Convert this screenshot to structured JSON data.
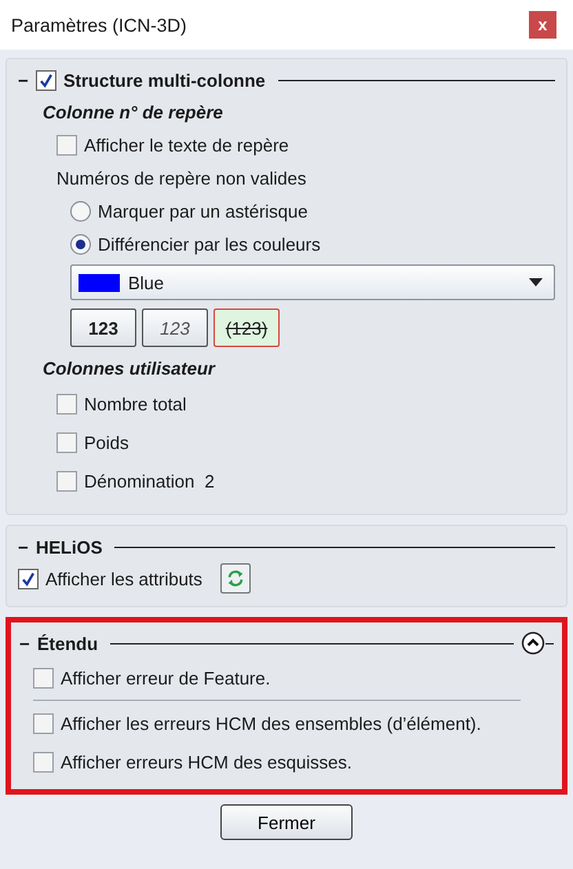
{
  "window": {
    "title": "Paramètres (ICN-3D)",
    "close": "x"
  },
  "structure": {
    "collapse": "−",
    "checked": true,
    "label": "Structure multi-colonne",
    "repere": {
      "heading": "Colonne n° de repère",
      "show_text": {
        "label": "Afficher le texte de repère",
        "checked": false
      },
      "invalid_label": "Numéros de repère non valides",
      "radios": [
        {
          "label": "Marquer par un astérisque",
          "selected": false
        },
        {
          "label": "Différencier par les couleurs",
          "selected": true
        }
      ],
      "color_select": {
        "value": "Blue",
        "color": "#0000ff"
      },
      "styles": [
        {
          "label": "123",
          "kind": "bold"
        },
        {
          "label": "123",
          "kind": "italic"
        },
        {
          "label": "(123)",
          "kind": "strike"
        }
      ]
    },
    "user_columns": {
      "heading": "Colonnes utilisateur",
      "items": [
        {
          "label": "Nombre total",
          "checked": false
        },
        {
          "label": "Poids",
          "checked": false
        },
        {
          "label": "Dénomination  2",
          "checked": false
        }
      ]
    }
  },
  "helios": {
    "collapse": "−",
    "label": "HELiOS",
    "show_attributes": {
      "label": "Afficher les attributs",
      "checked": true
    }
  },
  "extended": {
    "collapse": "−",
    "label": "Étendu",
    "highlighted": true,
    "items": [
      {
        "label": "Afficher erreur de Feature.",
        "checked": false
      },
      {
        "label": "Afficher les erreurs HCM des ensembles (d’élément).",
        "checked": false
      },
      {
        "label": "Afficher erreurs HCM des esquisses.",
        "checked": false
      }
    ]
  },
  "close_button": "Fermer"
}
